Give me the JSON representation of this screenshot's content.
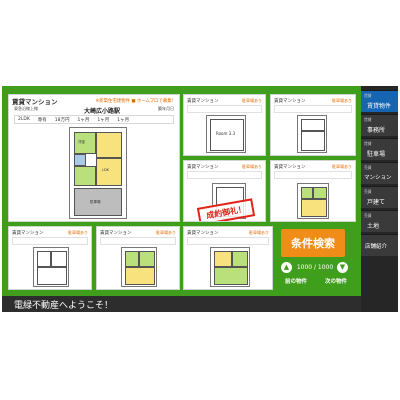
{
  "main_card": {
    "title": "賃貸マンション",
    "badge": "※新築住宅建物件 ■ ホームプロで募集！",
    "address": "東急沿線上線",
    "station": "大崎広小路駅",
    "date": "築年月日",
    "specs": [
      "2LDK",
      "専有",
      "18万円",
      "1ヶ月",
      "1ヶ月",
      "1ヶ月"
    ],
    "room_label_1": "洋室",
    "room_label_2": "LDK",
    "room_label_3": "駐車場"
  },
  "cards": [
    {
      "title": "賃貸マンション",
      "badge": "駐車場あり"
    },
    {
      "title": "賃貸マンション",
      "badge": "駐車場あり"
    },
    {
      "title": "賃貸マンション",
      "badge": "駐車場あり"
    },
    {
      "title": "賃貸マンション",
      "badge": "駐車場あり"
    },
    {
      "title": "賃貸マンション",
      "badge": "駐車場あり"
    },
    {
      "title": "賃貸マンション",
      "badge": "駐車場あり"
    },
    {
      "title": "賃貸マンション",
      "badge": "駐車場あり"
    }
  ],
  "stamp_text": "成約御礼！",
  "room_text": "Room 3.3",
  "sidebar": {
    "items": [
      {
        "tag": "賃貸",
        "label": "賃貸物件"
      },
      {
        "tag": "賃貸",
        "label": "事務所"
      },
      {
        "tag": "賃貸",
        "label": "駐車場"
      },
      {
        "tag": "売買",
        "label": "マンション"
      },
      {
        "tag": "売買",
        "label": "戸建て"
      },
      {
        "tag": "売買",
        "label": "土地"
      },
      {
        "tag": "",
        "label": "店舗紹介"
      }
    ]
  },
  "search_button": "条件検索",
  "pager": {
    "counter": "1000 / 1000",
    "prev_label": "前の物件",
    "next_label": "次の物件"
  },
  "footer_text": "電緑不動産へようこそ！",
  "colors": {
    "background_green": "#3f9e1c",
    "search_orange": "#f08c18",
    "sidebar_active": "#1565b3",
    "stamp_red": "#e2231a"
  }
}
